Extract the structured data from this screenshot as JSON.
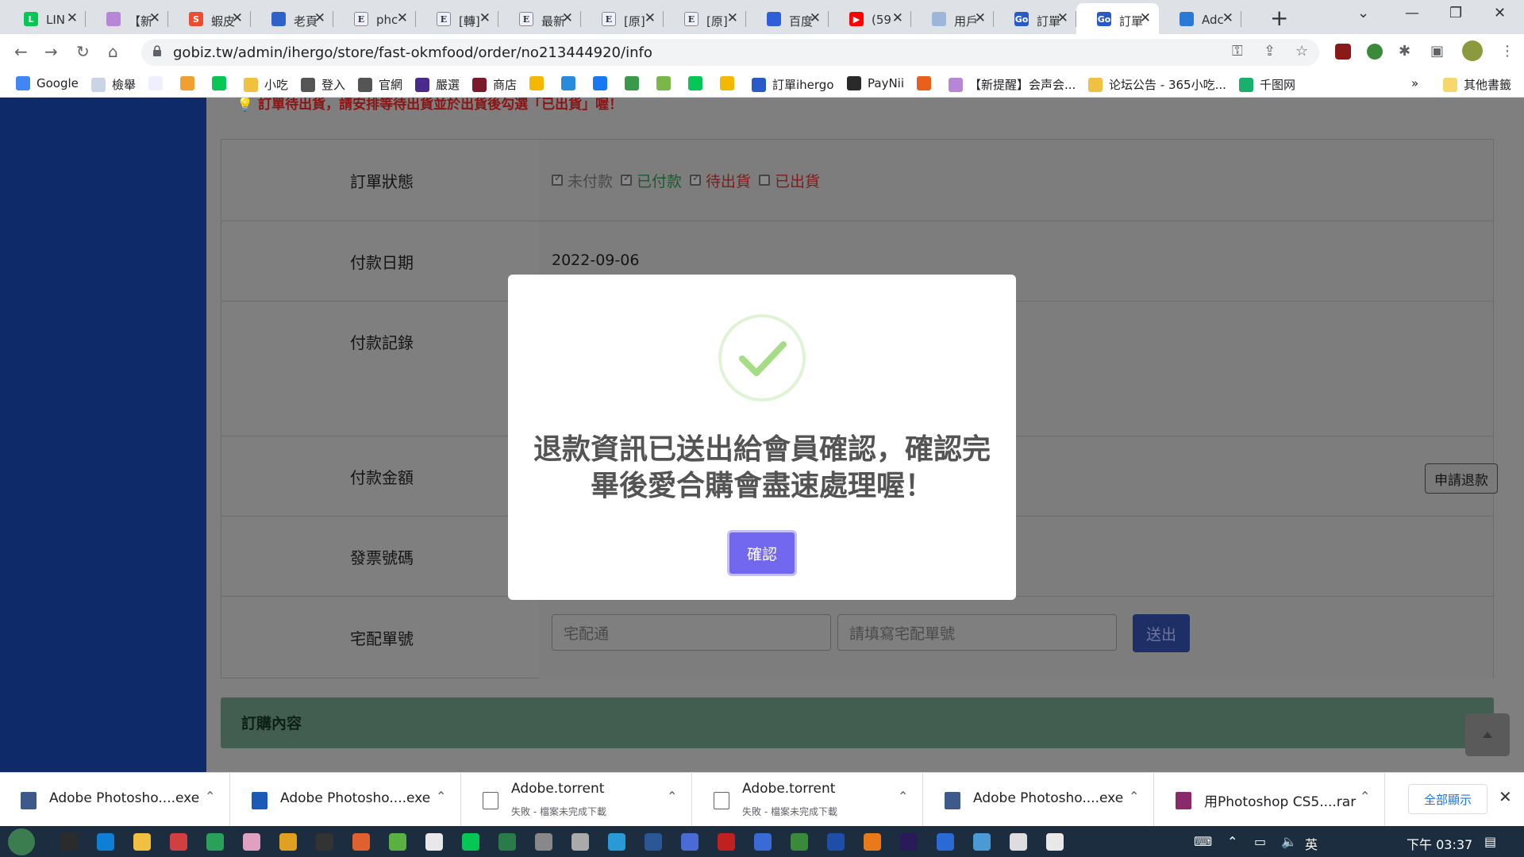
{
  "browser": {
    "tabs": [
      {
        "title": "LIN",
        "icon": "line-icon",
        "color": "#06c755",
        "glyph": "L"
      },
      {
        "title": "【新",
        "icon": "app-icon",
        "color": "#b886d6",
        "glyph": ""
      },
      {
        "title": "蝦皮",
        "icon": "shopee-icon",
        "color": "#ee4d2d",
        "glyph": "S"
      },
      {
        "title": "老頁",
        "icon": "chat-icon",
        "color": "#2f62c9",
        "glyph": ""
      },
      {
        "title": "phc",
        "icon": "e-icon",
        "color": "#eef0ff",
        "glyph": "E"
      },
      {
        "title": "[轉]",
        "icon": "e-icon",
        "color": "#eef0ff",
        "glyph": "E"
      },
      {
        "title": "最新",
        "icon": "e-icon",
        "color": "#eef0ff",
        "glyph": "E"
      },
      {
        "title": "[原]",
        "icon": "e-icon",
        "color": "#eef0ff",
        "glyph": "E"
      },
      {
        "title": "[原]",
        "icon": "e-icon",
        "color": "#eef0ff",
        "glyph": "E"
      },
      {
        "title": "百度",
        "icon": "baidu-icon",
        "color": "#2e5fd8",
        "glyph": ""
      },
      {
        "title": "(59",
        "icon": "youtube-icon",
        "color": "#ff0000",
        "glyph": "▶"
      },
      {
        "title": "用戶",
        "icon": "bird-icon",
        "color": "#9bb6d8",
        "glyph": ""
      },
      {
        "title": "訂單",
        "icon": "gobiz-icon",
        "color": "#2a5ac8",
        "glyph": "Go"
      },
      {
        "title": "訂單",
        "icon": "gobiz-icon",
        "color": "#2a5ac8",
        "glyph": "Go",
        "active": true
      },
      {
        "title": "Adc",
        "icon": "globe-icon",
        "color": "#2a79d6",
        "glyph": ""
      }
    ],
    "new_tab_glyph": "+",
    "url": "gobiz.tw/admin/ihergo/store/fast-okmfood/order/no213444920/info",
    "bookmarks": [
      {
        "label": "Google",
        "color": "#4285f4"
      },
      {
        "label": "檢舉",
        "color": "#c9d4e6"
      },
      {
        "label": "",
        "color": "#eef0ff"
      },
      {
        "label": "",
        "color": "#f0a030"
      },
      {
        "label": "",
        "color": "#06c755"
      },
      {
        "label": "小吃",
        "color": "#f0c040"
      },
      {
        "label": "登入",
        "color": "#555555"
      },
      {
        "label": "官網",
        "color": "#555555"
      },
      {
        "label": "嚴選",
        "color": "#4a2a8a"
      },
      {
        "label": "商店",
        "color": "#7a1a2a"
      },
      {
        "label": "",
        "color": "#f5b800"
      },
      {
        "label": "",
        "color": "#2a8adc"
      },
      {
        "label": "",
        "color": "#1877f2"
      },
      {
        "label": "",
        "color": "#3a9a4a"
      },
      {
        "label": "",
        "color": "#7ab648"
      },
      {
        "label": "",
        "color": "#06c755"
      },
      {
        "label": "",
        "color": "#f5b800"
      },
      {
        "label": "訂單ihergo",
        "color": "#2a5ac8"
      },
      {
        "label": "PayNii",
        "color": "#2a2a2a"
      },
      {
        "label": "",
        "color": "#e8601c"
      },
      {
        "label": "【新提醒】会声会...",
        "color": "#b886d6"
      },
      {
        "label": "论坛公告 - 365小吃...",
        "color": "#f0c040"
      },
      {
        "label": "千图网",
        "color": "#18b06a"
      }
    ],
    "bookmarks_more": "»",
    "other_bookmarks": "其他書籤"
  },
  "page": {
    "warning": "訂單待出貨，請安排等待出貨並於出貨後勾選「已出貨」喔！",
    "rows": {
      "status": {
        "label": "訂單狀態",
        "options": [
          {
            "text": "未付款",
            "checked": true,
            "color": "#4a4a4a"
          },
          {
            "text": "已付款",
            "checked": true,
            "color": "#1a5a2e"
          },
          {
            "text": "待出貨",
            "checked": true,
            "color": "#7a1e1e"
          },
          {
            "text": "已出貨",
            "checked": false,
            "color": "#7a1e1e"
          }
        ]
      },
      "pay_date": {
        "label": "付款日期",
        "value": "2022-09-06"
      },
      "pay_record": {
        "label": "付款記錄"
      },
      "pay_amount": {
        "label": "付款金額",
        "refund_button": "申請退款"
      },
      "invoice": {
        "label": "發票號碼"
      },
      "tracking": {
        "label": "宅配單號",
        "carrier": "宅配通",
        "tracking_placeholder": "請填寫宅配單號",
        "submit": "送出"
      }
    },
    "order_panel_title": "訂購內容"
  },
  "modal": {
    "message": "退款資訊已送出給會員確認，確認完畢後愛合購會盡速處理喔！",
    "confirm": "確認",
    "accent": "#7267ef",
    "success_color": "#a5dc86"
  },
  "downloads": {
    "items": [
      {
        "name": "Adobe Photosho....exe",
        "sub": "",
        "icon": "installer-icon",
        "color": "#3d5a8a"
      },
      {
        "name": "Adobe Photosho....exe",
        "sub": "",
        "icon": "photoshop-icon",
        "color": "#1d5ab8"
      },
      {
        "name": "Adobe.torrent",
        "sub": "失敗 - 檔案未完成下載",
        "icon": "file-icon",
        "color": "#ffffff"
      },
      {
        "name": "Adobe.torrent",
        "sub": "失敗 - 檔案未完成下載",
        "icon": "file-icon",
        "color": "#ffffff"
      },
      {
        "name": "Adobe Photosho....exe",
        "sub": "",
        "icon": "installer-icon",
        "color": "#3d5a8a"
      },
      {
        "name": "用Photoshop CS5....rar",
        "sub": "",
        "icon": "rar-icon",
        "color": "#8a2a6a"
      }
    ],
    "show_all": "全部顯示"
  },
  "taskbar": {
    "apps": [
      "#2b2b2b",
      "#0f7fd6",
      "#f0c040",
      "#d04040",
      "#2aa05a",
      "#e0a0c0",
      "#e0a020",
      "#333333",
      "#e06030",
      "#5ab040",
      "#e8e8e8",
      "#06c755",
      "#2a7a4a",
      "#888888",
      "#aaaaaa",
      "#2a9ad6",
      "#2b5797",
      "#4a6ad6",
      "#c02020",
      "#3a6ad6",
      "#3a8a3a",
      "#1f4ea8",
      "#e87a1a",
      "#2a1a5a",
      "#2a6ad6",
      "#4a9ad6",
      "#dddddd",
      "#e8e8e8"
    ],
    "ime": "英",
    "time": "下午 03:37"
  }
}
